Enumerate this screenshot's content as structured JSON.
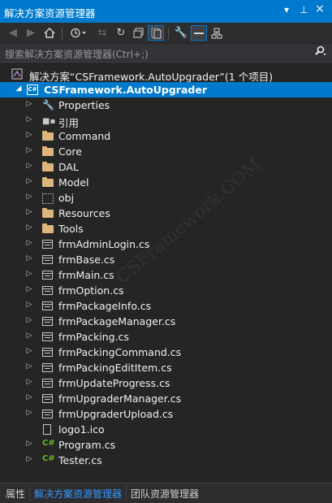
{
  "titlebar": {
    "title": "解决方案资源管理器",
    "dropdown_icon": "▾",
    "pin_icon": "⊥",
    "close_icon": "×"
  },
  "search": {
    "placeholder": "搜索解决方案资源管理器(Ctrl+;)"
  },
  "solution": {
    "label": "解决方案“CSFramework.AutoUpgrader”(1 个项目)"
  },
  "project": {
    "label": "CSFramework.AutoUpgrader",
    "icon_text": "C#"
  },
  "items": [
    {
      "label": "Properties",
      "icon": "wrench"
    },
    {
      "label": "引用",
      "icon": "references"
    },
    {
      "label": "Command",
      "icon": "folder"
    },
    {
      "label": "Core",
      "icon": "folder"
    },
    {
      "label": "DAL",
      "icon": "folder"
    },
    {
      "label": "Model",
      "icon": "folder"
    },
    {
      "label": "obj",
      "icon": "folder-hidden"
    },
    {
      "label": "Resources",
      "icon": "folder"
    },
    {
      "label": "Tools",
      "icon": "folder"
    },
    {
      "label": "frmAdminLogin.cs",
      "icon": "form"
    },
    {
      "label": "frmBase.cs",
      "icon": "form"
    },
    {
      "label": "frmMain.cs",
      "icon": "form"
    },
    {
      "label": "frmOption.cs",
      "icon": "form"
    },
    {
      "label": "frmPackageInfo.cs",
      "icon": "form"
    },
    {
      "label": "frmPackageManager.cs",
      "icon": "form"
    },
    {
      "label": "frmPacking.cs",
      "icon": "form"
    },
    {
      "label": "frmPackingCommand.cs",
      "icon": "form"
    },
    {
      "label": "frmPackingEditItem.cs",
      "icon": "form"
    },
    {
      "label": "frmUpdateProgress.cs",
      "icon": "form"
    },
    {
      "label": "frmUpgraderManager.cs",
      "icon": "form"
    },
    {
      "label": "frmUpgraderUpload.cs",
      "icon": "form"
    },
    {
      "label": "logo1.ico",
      "icon": "file"
    },
    {
      "label": "Program.cs",
      "icon": "csharp"
    },
    {
      "label": "Tester.cs",
      "icon": "csharp"
    }
  ],
  "bottom_tabs": [
    {
      "label": "属性"
    },
    {
      "label": "解决方案资源管理器"
    },
    {
      "label": "团队资源管理器"
    }
  ],
  "colors": {
    "accent": "#007acc",
    "background": "#252526",
    "folder": "#dcb67a",
    "csharp": "#68b723"
  }
}
